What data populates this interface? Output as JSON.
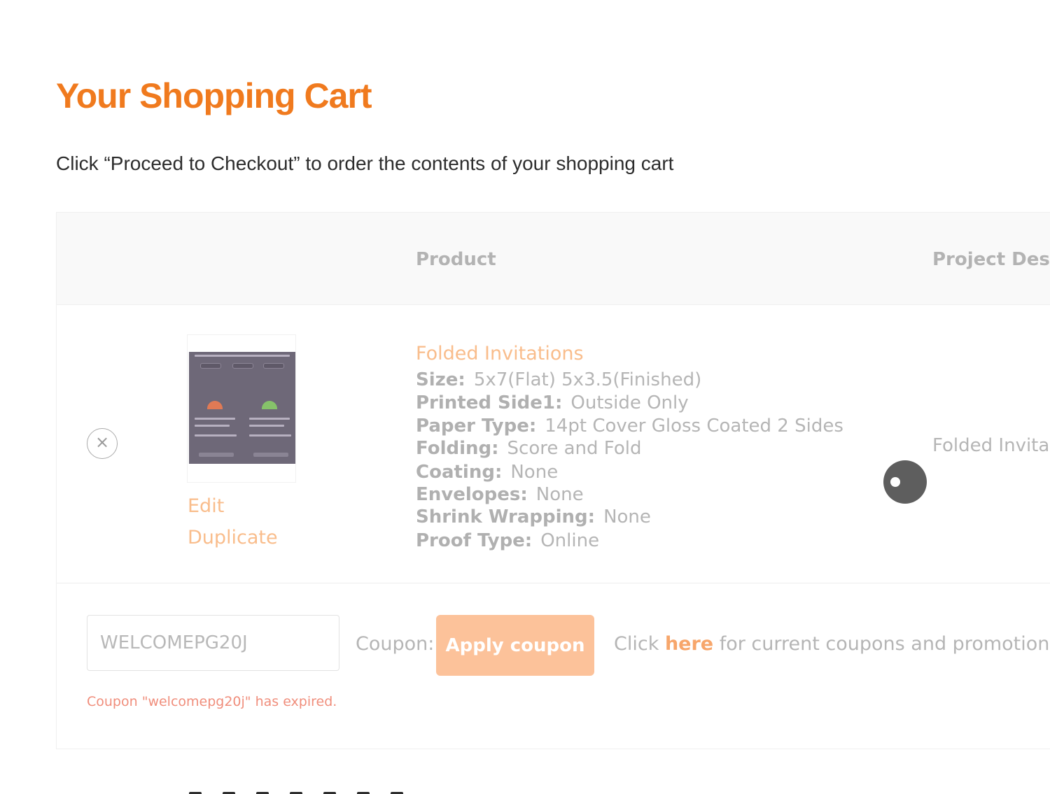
{
  "page": {
    "title": "Your Shopping Cart",
    "intro": "Click “Proceed to Checkout” to order the contents of your shopping cart"
  },
  "cart_table": {
    "columns": [
      "Product",
      "Project Desc"
    ]
  },
  "cart_item": {
    "remove_icon": "×",
    "thumbnail_icon": "product-thumbnail",
    "edit_label": "Edit",
    "duplicate_label": "Duplicate",
    "product_name": "Folded Invitations",
    "specs": [
      {
        "label": "Size:",
        "value": "5x7(Flat) 5x3.5(Finished)"
      },
      {
        "label": "Printed Side1:",
        "value": "Outside Only"
      },
      {
        "label": "Paper Type:",
        "value": "14pt Cover Gloss Coated 2 Sides"
      },
      {
        "label": "Folding:",
        "value": "Score and Fold"
      },
      {
        "label": "Coating:",
        "value": "None"
      },
      {
        "label": "Envelopes:",
        "value": "None"
      },
      {
        "label": "Shrink Wrapping:",
        "value": "None"
      },
      {
        "label": "Proof Type:",
        "value": "Online"
      }
    ],
    "project_description": "Folded Invita"
  },
  "coupon": {
    "input_value": "WELCOMEPG20J",
    "label": "Coupon:",
    "apply_label": "Apply coupon",
    "promo_prefix": "Click",
    "promo_link": "here",
    "promo_suffix": "for current coupons and promotions",
    "error": "Coupon \"welcomepg20j\" has expired."
  },
  "colors": {
    "accent": "#f07a1e",
    "link_faded": "#f9bd8c",
    "button_faded": "#fcc29a",
    "error": "#f08e7c"
  }
}
